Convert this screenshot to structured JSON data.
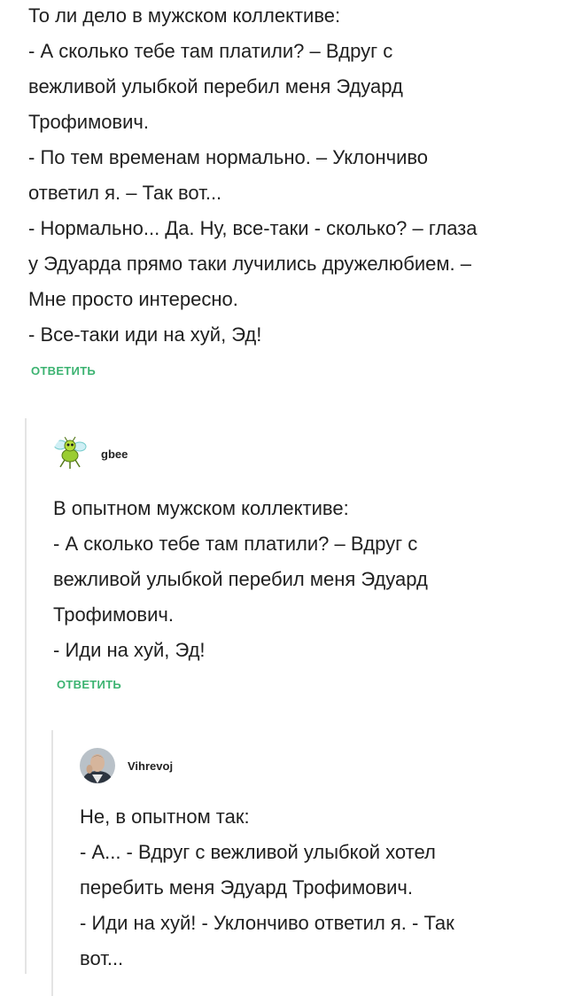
{
  "top_comment": {
    "lines": [
      "То ли дело в мужском коллективе:",
      "- А сколько тебе там платили? – Вдруг с",
      "вежливой улыбкой перебил меня Эдуард",
      "Трофимович.",
      "- По тем временам нормально. – Уклончиво",
      "ответил я. – Так вот...",
      "- Нормально... Да. Ну, все-таки - сколько? – глаза",
      "у Эдуарда прямо таки лучились дружелюбием. –",
      "Мне просто интересно.",
      "- Все-таки иди на хуй, Эд!"
    ],
    "reply_label": "ОТВЕТИТЬ"
  },
  "reply_1": {
    "author": "gbee",
    "avatar_icon": "bee-icon",
    "lines": [
      "В опытном мужском коллективе:",
      "- А сколько тебе там платили? – Вдруг с",
      "вежливой улыбкой перебил меня Эдуард",
      "Трофимович.",
      "- Иди на хуй, Эд!"
    ],
    "reply_label": "ОТВЕТИТЬ"
  },
  "reply_2": {
    "author": "Vihrevoj",
    "avatar_icon": "user-photo-avatar",
    "lines": [
      "Не, в опытном так:",
      "- А... - Вдруг с вежливой улыбкой хотел",
      "перебить меня Эдуард Трофимович.",
      "- Иди на хуй! - Уклончиво ответил я. - Так",
      "вот..."
    ]
  },
  "colors": {
    "link": "#3cb371",
    "thread_line": "#e4e4e4",
    "text": "#1f1f1f"
  }
}
